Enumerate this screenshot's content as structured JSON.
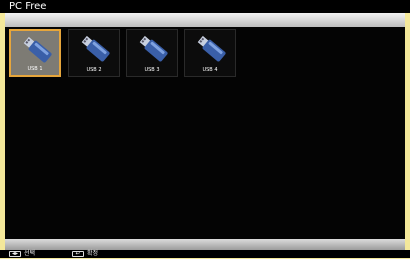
{
  "window": {
    "title": "PC Free"
  },
  "devices": [
    {
      "label": "USB 1",
      "selected": true
    },
    {
      "label": "USB 2",
      "selected": false
    },
    {
      "label": "USB 3",
      "selected": false
    },
    {
      "label": "USB 4",
      "selected": false
    }
  ],
  "footer": {
    "select_key_icon": "left-right-arrows-icon",
    "select_label": "선택",
    "enter_key_icon": "enter-icon",
    "enter_label": "확정"
  },
  "colors": {
    "selection_border": "#e6a63c",
    "background": "#040404",
    "usb_body": "#3a5fa8",
    "usb_connector": "#c8d0e0"
  }
}
